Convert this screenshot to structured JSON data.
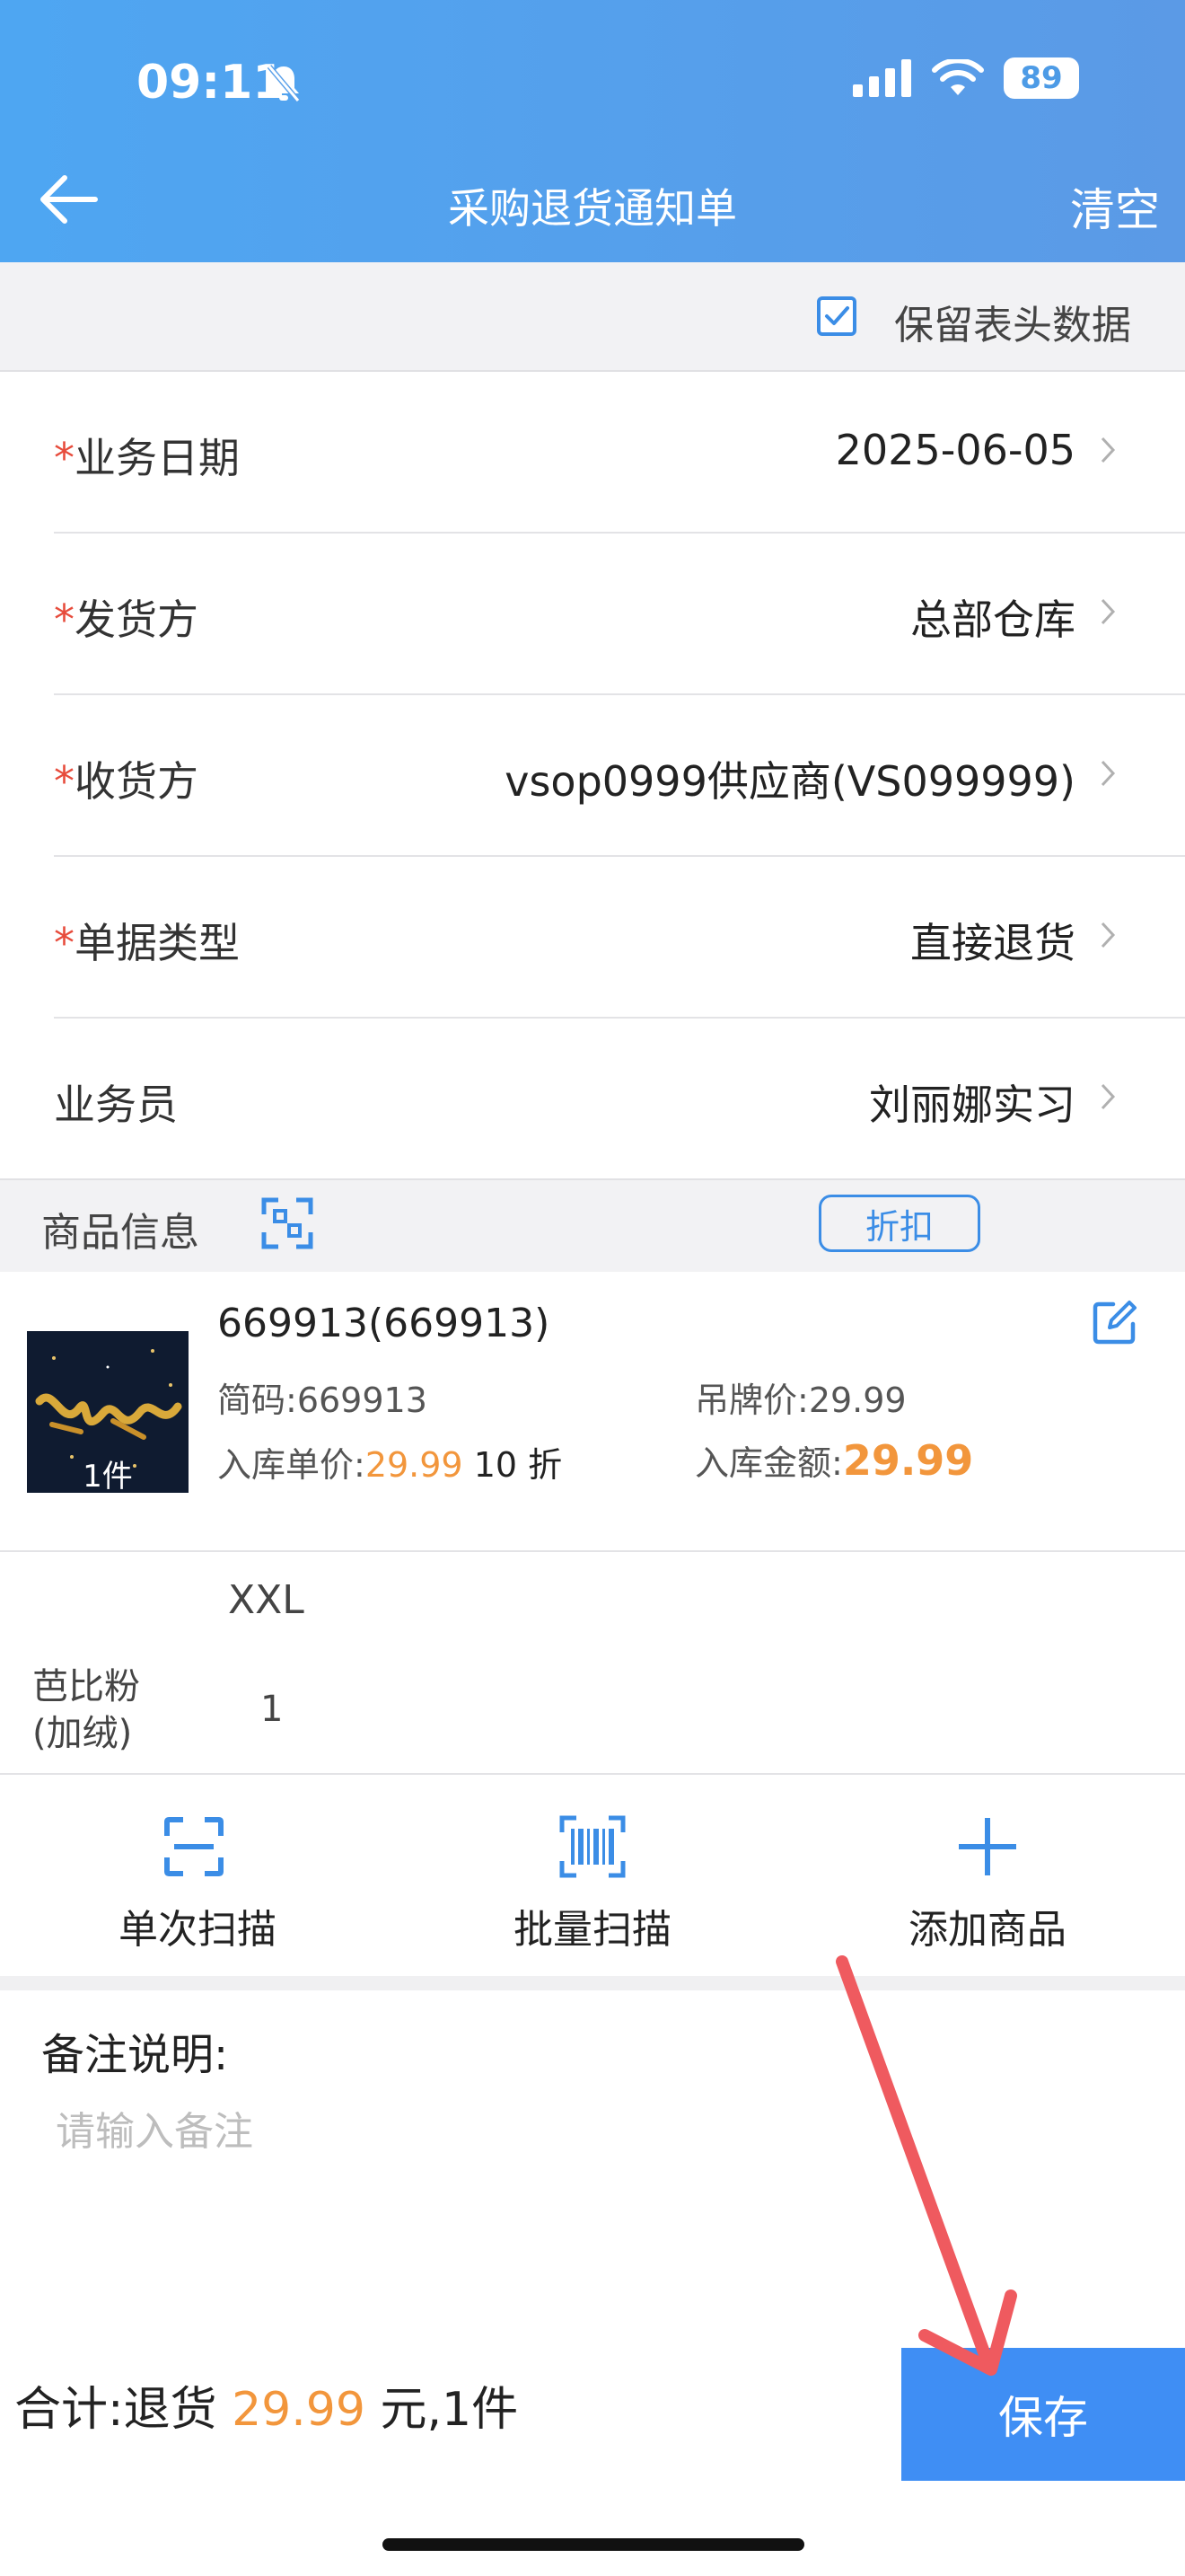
{
  "status": {
    "time": "09:11",
    "battery": "89"
  },
  "header": {
    "title": "采购退货通知单",
    "clear_label": "清空"
  },
  "keep_header": {
    "label": "保留表头数据",
    "checked": true
  },
  "form": {
    "rows": [
      {
        "label": "业务日期",
        "required": "*",
        "value": "2025-06-05"
      },
      {
        "label": "发货方",
        "required": "*",
        "value": "总部仓库"
      },
      {
        "label": "收货方",
        "required": "*",
        "value": "vsop0999供应商(VS099999)"
      },
      {
        "label": "单据类型",
        "required": "*",
        "value": "直接退货"
      },
      {
        "label": "业务员",
        "required": "",
        "value": "刘丽娜实习"
      }
    ]
  },
  "goods": {
    "title": "商品信息",
    "discount_label": "折扣",
    "product": {
      "name": "669913(669913)",
      "code_label": "简码:",
      "code": "669913",
      "tag_price_label": "吊牌价:",
      "tag_price": "29.99",
      "in_price_label": "入库单价:",
      "in_price": "29.99",
      "discount": "10 折",
      "in_amount_label": "入库金额:",
      "in_amount": "29.99",
      "thumb_qty": "1件"
    },
    "size_header": "XXL",
    "color_row": {
      "color": "芭比粉(加绒)",
      "qty": "1"
    }
  },
  "actions": {
    "single_scan": "单次扫描",
    "batch_scan": "批量扫描",
    "add_goods": "添加商品"
  },
  "remark": {
    "label": "备注说明:",
    "placeholder": "请输入备注"
  },
  "footer": {
    "total_prefix": "合计:退货 ",
    "total_amount": "29.99",
    "total_suffix": " 元,1件",
    "save_label": "保存"
  },
  "colors": {
    "primary": "#3f8ef4",
    "accent_orange": "#f2963c",
    "required_red": "#e74c3c",
    "annotation_arrow": "#ef5a5f"
  }
}
